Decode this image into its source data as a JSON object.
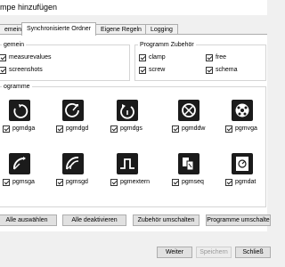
{
  "window": {
    "title": "mpe hinzufügen"
  },
  "tabs": [
    {
      "label": "emein",
      "active": false
    },
    {
      "label": "Synchronisierte Ordner",
      "active": true
    },
    {
      "label": "Eigene Regeln",
      "active": false
    },
    {
      "label": "Logging",
      "active": false
    }
  ],
  "group_general": {
    "title": "gemein",
    "items": [
      {
        "label": "measurevalues",
        "checked": true
      },
      {
        "label": "screenshots",
        "checked": true
      }
    ]
  },
  "group_accessories": {
    "title": "Programm Zubehör",
    "items": [
      {
        "label": "clamp",
        "checked": true
      },
      {
        "label": "free",
        "checked": true
      },
      {
        "label": "screw",
        "checked": true
      },
      {
        "label": "schema",
        "checked": true
      }
    ]
  },
  "group_programs": {
    "title": "ogramme",
    "items": [
      {
        "label": "pgmdga",
        "checked": true,
        "icon": "circular-arrow-icon"
      },
      {
        "label": "pgmdgd",
        "checked": true,
        "icon": "rotate-dial-icon"
      },
      {
        "label": "pgmdgs",
        "checked": true,
        "icon": "refresh-dial-icon"
      },
      {
        "label": "pgmddw",
        "checked": true,
        "icon": "crossed-circle-icon"
      },
      {
        "label": "pgmvga",
        "checked": true,
        "icon": "ball-icon"
      },
      {
        "label": "pgmsga",
        "checked": true,
        "icon": "arc-arrow-icon"
      },
      {
        "label": "pgmsgd",
        "checked": true,
        "icon": "double-arc-icon"
      },
      {
        "label": "pgmextern",
        "checked": true,
        "icon": "pulse-step-icon"
      },
      {
        "label": "pgmseq",
        "checked": true,
        "icon": "cards-sequence-icon"
      },
      {
        "label": "pgmdat",
        "checked": true,
        "icon": "document-dial-icon"
      }
    ]
  },
  "actions": {
    "select_all": "Alle auswählen",
    "deselect_all": "Alle deaktivieren",
    "toggle_accessories": "Zubehör umschalten",
    "toggle_programs": "Programme umschalte"
  },
  "footer": {
    "next": "Weiter",
    "save": "Speichern",
    "close": "Schließ"
  }
}
